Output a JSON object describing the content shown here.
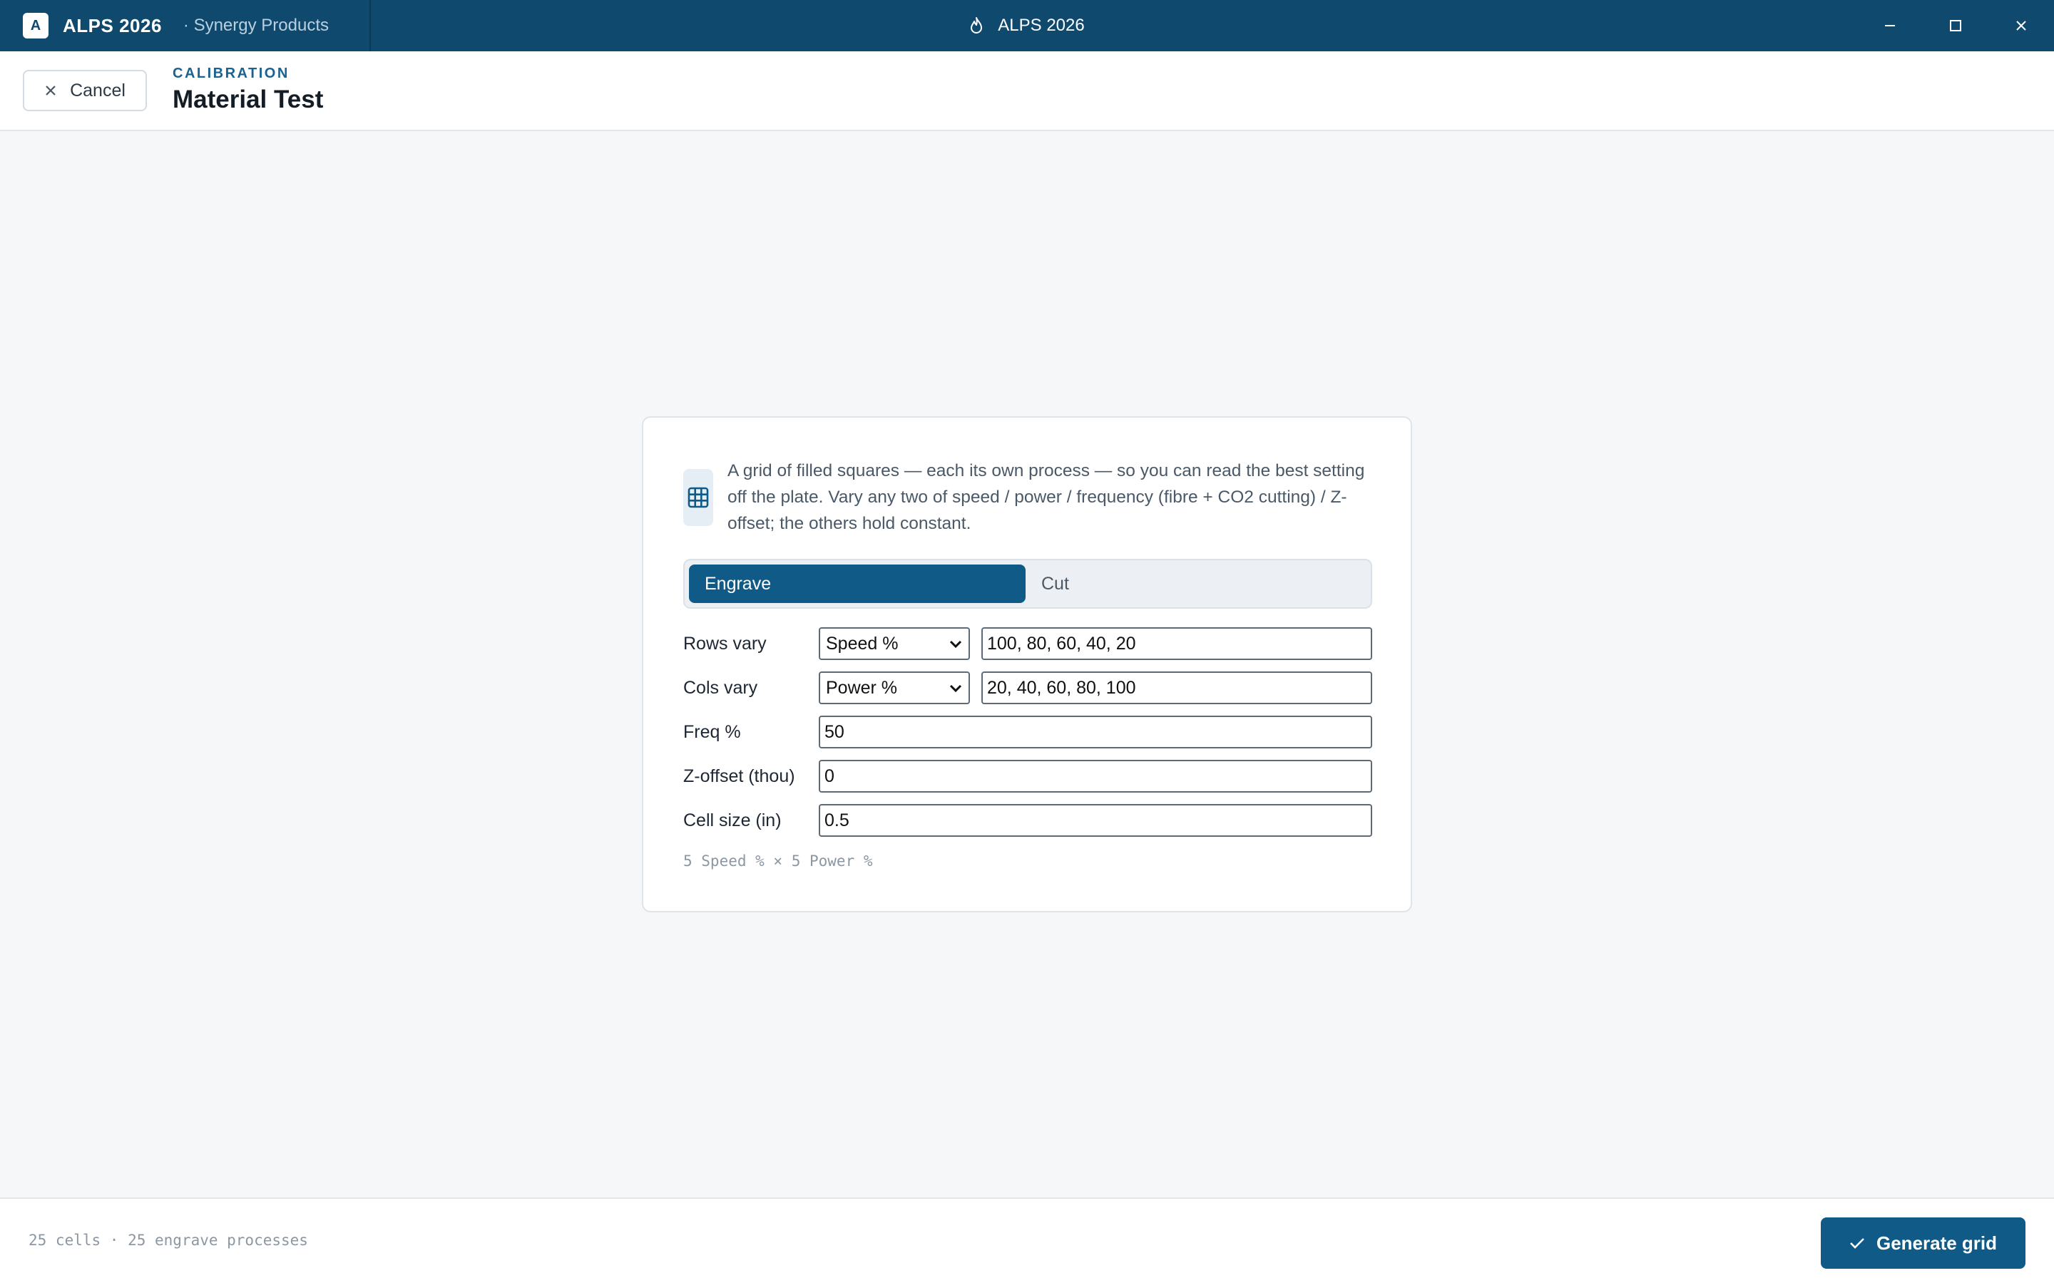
{
  "titlebar": {
    "logo_letter": "A",
    "app_name": "ALPS 2026",
    "org": "· Synergy Products",
    "window_title": "ALPS 2026",
    "title_icon": "flame-icon"
  },
  "header": {
    "cancel_label": "Cancel",
    "eyebrow": "CALIBRATION",
    "title": "Material Test"
  },
  "card": {
    "icon": "grid-icon",
    "intro": "A grid of filled squares — each its own process — so you can read the best setting off the plate. Vary any two of speed / power / frequency (fibre + CO2 cutting) / Z-offset; the others hold constant.",
    "modes": {
      "active": "Engrave",
      "inactive": "Cut"
    },
    "rows": {
      "label": "Rows vary",
      "select": "Speed %",
      "values": "100, 80, 60, 40, 20"
    },
    "cols": {
      "label": "Cols vary",
      "select": "Power %",
      "values": "20, 40, 60, 80, 100"
    },
    "freq": {
      "label": "Freq %",
      "value": "50"
    },
    "zoffset": {
      "label": "Z-offset (thou)",
      "value": "0"
    },
    "cellsize": {
      "label": "Cell size (in)",
      "value": "0.5"
    },
    "summary": "5 Speed % × 5 Power %"
  },
  "footer": {
    "status": "25 cells · 25 engrave processes",
    "generate_label": "Generate grid"
  },
  "colors": {
    "titlebar": "#0f4a6e",
    "accent": "#0f5a86",
    "background": "#f5f7f9"
  }
}
